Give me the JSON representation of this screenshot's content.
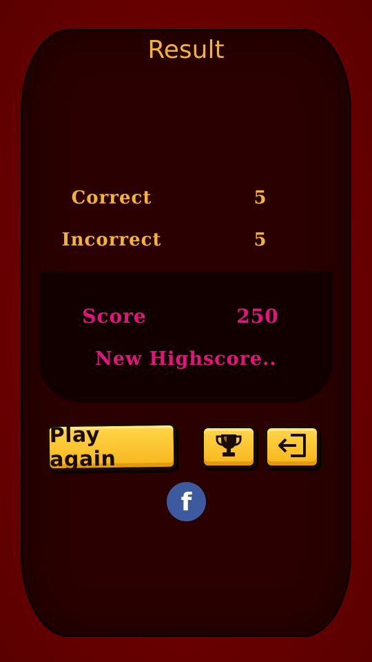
{
  "title": "Result",
  "stats": {
    "correct_label": "Correct",
    "correct_value": "5",
    "incorrect_label": "Incorrect",
    "incorrect_value": "5"
  },
  "score": {
    "label": "Score",
    "value": "250",
    "message": "New Highscore.."
  },
  "buttons": {
    "play_again_label": "Play again",
    "trophy_icon": "trophy-icon",
    "exit_icon": "exit-icon",
    "facebook_icon": "facebook-icon",
    "facebook_glyph": "f"
  },
  "colors": {
    "background": "#6a0000",
    "panel": "#2a0000",
    "stat_text": "#f3b33b",
    "score_text": "#e0167f",
    "button": "#f7b51c",
    "facebook": "#3d5a9e"
  }
}
